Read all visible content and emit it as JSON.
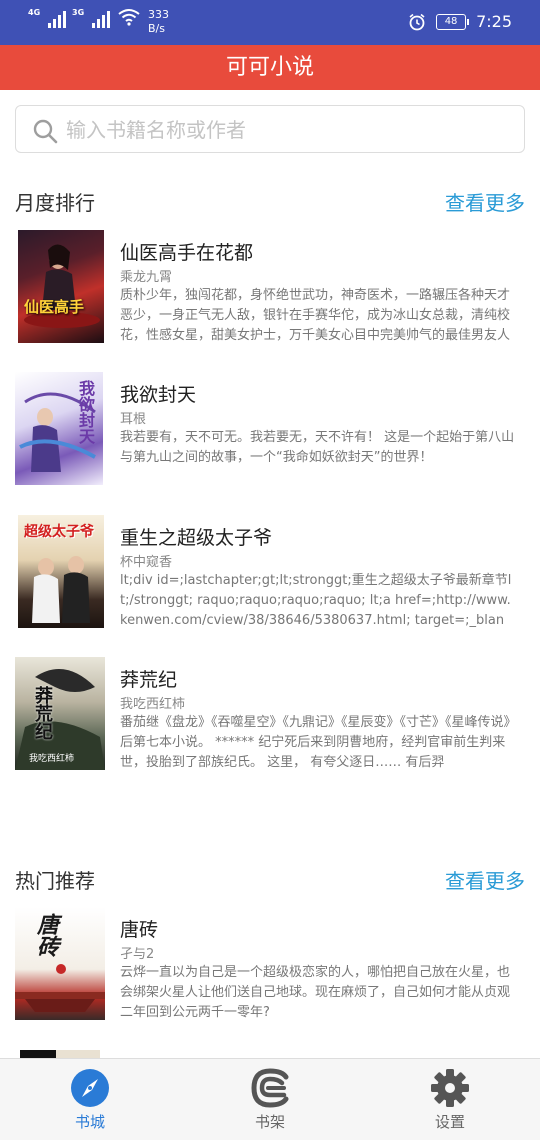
{
  "status_bar": {
    "net1": "4G",
    "net2": "3G",
    "speed_value": "333",
    "speed_unit": "B/s",
    "battery": "48",
    "time": "7:25"
  },
  "app": {
    "title": "可可小说"
  },
  "search": {
    "placeholder": "输入书籍名称或作者",
    "value": ""
  },
  "monthly": {
    "title": "月度排行",
    "more_label": "查看更多",
    "books": [
      {
        "name": "仙医高手在花都",
        "author": "乘龙九霄",
        "desc": "质朴少年，独闯花都，身怀绝世武功，神奇医术，一路辗压各种天才恶少，一身正气无人敌，银针在手赛华佗，成为冰山女总裁，清纯校花，性感女星，甜美女护士，万千美女心目中完美帅气的最佳男友人",
        "cover_text": "仙医高手"
      },
      {
        "name": "我欲封天",
        "author": "耳根",
        "desc": "我若要有，天不可无。我若要无，天不许有！ 这是一个起始于第八山与第九山之间的故事，一个“我命如妖欲封天”的世界！",
        "cover_text": "我欲封天"
      },
      {
        "name": "重生之超级太子爷",
        "author": "杯中窥香",
        "desc": "lt;div id=;lastchapter;gt;lt;stronggt;重生之超级太子爷最新章节lt;/stronggt; raquo;raquo;raquo;raquo; lt;a href=;http://www.kenwen.com/cview/38/38646/5380637.html; target=;_blank;gt; 第一卷",
        "cover_text": "超级太子爷"
      },
      {
        "name": "莽荒纪",
        "author": "我吃西红柿",
        "desc": "番茄继《盘龙》《吞噬星空》《九鼎记》《星辰变》《寸芒》《星峰传说》后第七本小说。 ****** 纪宁死后来到阴曹地府，经判官审前生判来世，投胎到了部族纪氏。 这里， 有夸父逐日…… 有后羿",
        "cover_text": "莽荒纪",
        "cover_author": "我吃西红柿"
      }
    ]
  },
  "hot": {
    "title": "热门推荐",
    "more_label": "查看更多",
    "books": [
      {
        "name": "唐砖",
        "author": "孑与2",
        "desc": "云烨一直以为自己是一个超级极恋家的人，哪怕把自己放在火星，也会绑架火星人让他们送自己地球。现在麻烦了，自己如何才能从贞观二年回到公元两千一零年?",
        "cover_text": "唐砖"
      }
    ]
  },
  "bottom_nav": [
    {
      "label": "书城",
      "icon": "compass-icon",
      "active": true
    },
    {
      "label": "书架",
      "icon": "bookshelf-icon",
      "active": false
    },
    {
      "label": "设置",
      "icon": "gear-icon",
      "active": false
    }
  ],
  "colors": {
    "status_bar": "#3f51b5",
    "title_bar": "#e84b3c",
    "accent_link": "#2a9bd6",
    "nav_active": "#2a7bd6"
  }
}
